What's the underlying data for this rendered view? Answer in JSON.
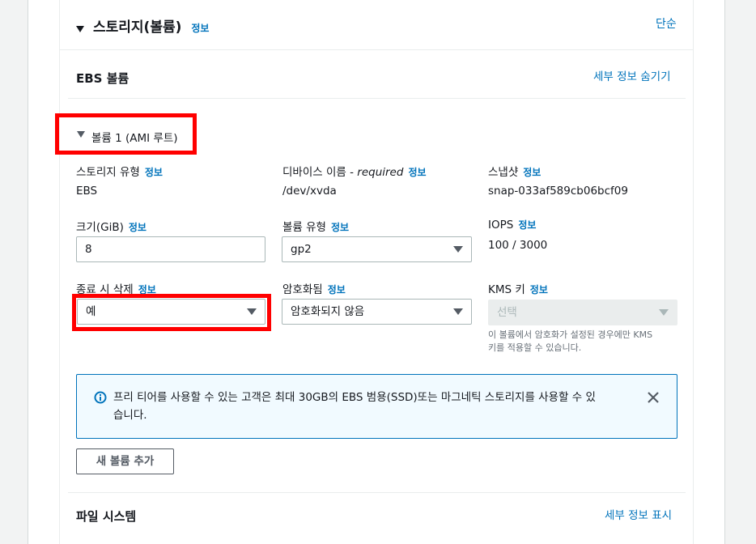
{
  "section": {
    "title": "스토리지(볼륨)",
    "info_label": "정보",
    "simple_link": "단순"
  },
  "ebs": {
    "title": "EBS 볼륨",
    "hide_details_link": "세부 정보 숨기기"
  },
  "volume": {
    "header": "볼륨 1 (AMI 루트)",
    "storage_type": {
      "label": "스토리지 유형",
      "info": "정보",
      "value": "EBS"
    },
    "device_name": {
      "label": "디바이스 이름 - ",
      "required": "required",
      "info": "정보",
      "value": "/dev/xvda"
    },
    "snapshot": {
      "label": "스냅샷",
      "info": "정보",
      "value": "snap-033af589cb06bcf09"
    },
    "size": {
      "label": "크기(GiB)",
      "info": "정보",
      "value": "8"
    },
    "volume_type": {
      "label": "볼륨 유형",
      "info": "정보",
      "value": "gp2"
    },
    "iops": {
      "label": "IOPS",
      "info": "정보",
      "value": "100 / 3000"
    },
    "delete_on_termination": {
      "label": "종료 시 삭제",
      "info": "정보",
      "value": "예"
    },
    "encrypted": {
      "label": "암호화됨",
      "info": "정보",
      "value": "암호화되지 않음"
    },
    "kms_key": {
      "label": "KMS 키",
      "info": "정보",
      "value": "선택",
      "hint_line1": "이 볼륨에서 암호화가 설정된 경우에만 KMS",
      "hint_line2": "키를 적용할 수 있습니다."
    }
  },
  "alert": {
    "line1": "프리 티어를 사용할 수 있는 고객은 최대 30GB의 EBS 범용(SSD)또는 마그네틱 스토리지를 사용할 수 있",
    "line2": "습니다."
  },
  "add_volume_button": "새 볼륨 추가",
  "file_system": {
    "title": "파일 시스템",
    "show_details_link": "세부 정보 표시"
  },
  "colors": {
    "link": "#0073bb",
    "highlight": "#ff0000",
    "alert_bg": "#f1faff"
  }
}
